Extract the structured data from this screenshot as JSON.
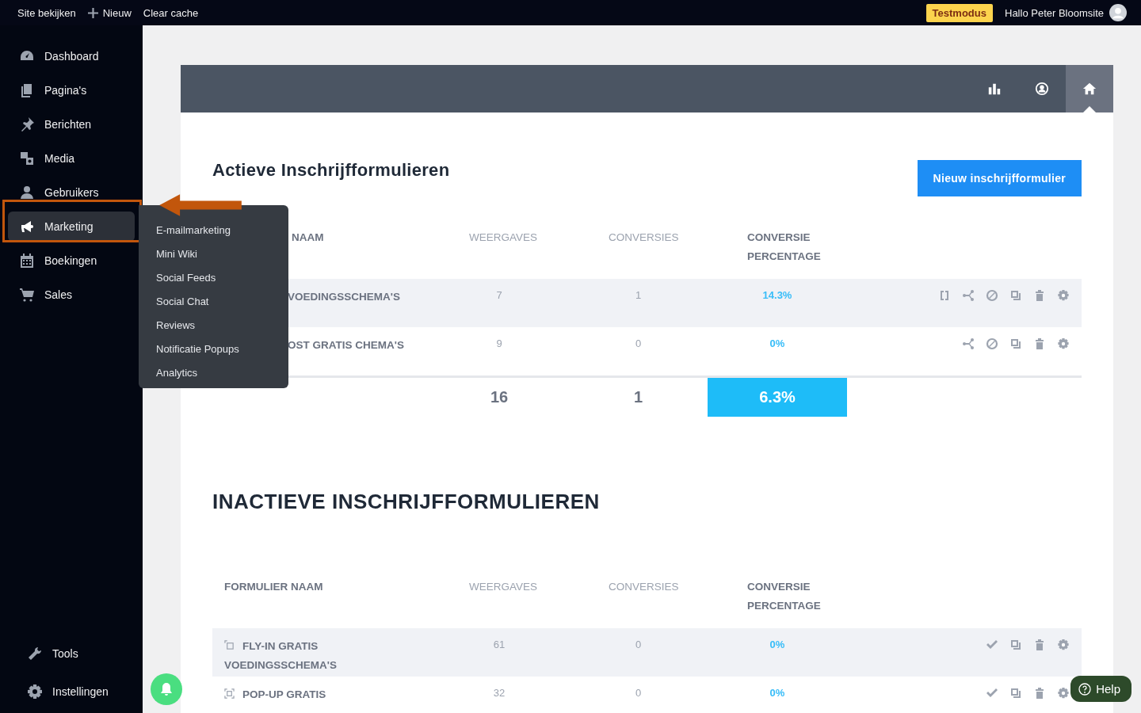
{
  "topbar": {
    "links": [
      {
        "kind": "site",
        "label": "Site bekijken"
      },
      {
        "kind": "new",
        "label": "Nieuw"
      },
      {
        "kind": "cache",
        "label": "Clear cache"
      }
    ],
    "badge": "Testmodus",
    "greeting": "Hallo Peter Bloomsite"
  },
  "sidebar": {
    "items": [
      {
        "kind": "dashboard",
        "label": "Dashboard",
        "selected": false
      },
      {
        "kind": "pages",
        "label": "Pagina's",
        "selected": false
      },
      {
        "kind": "pin",
        "label": "Berichten",
        "selected": false
      },
      {
        "kind": "media",
        "label": "Media",
        "selected": false
      },
      {
        "kind": "user",
        "label": "Gebruikers",
        "selected": false
      },
      {
        "kind": "megaphone",
        "label": "Marketing",
        "selected": true
      },
      {
        "kind": "calendar",
        "label": "Boekingen",
        "selected": false
      },
      {
        "kind": "cart",
        "label": "Sales",
        "selected": false
      }
    ],
    "bottom_items": [
      {
        "kind": "wrench",
        "label": "Tools",
        "selected": false
      },
      {
        "kind": "gear",
        "label": "Instellingen",
        "selected": false
      }
    ],
    "flyout": [
      "E-mailmarketing",
      "Mini Wiki",
      "Social Feeds",
      "Social Chat",
      "Reviews",
      "Notificatie Popups",
      "Analytics"
    ]
  },
  "tabs": [
    {
      "kind": "chart",
      "selected": false
    },
    {
      "kind": "user",
      "selected": false
    },
    {
      "kind": "home",
      "selected": true
    }
  ],
  "active": {
    "title": "Actieve Inschrijfformulieren",
    "new_button": "Nieuw inschrijfformulier",
    "columns": [
      "NAAM",
      "WEERGAVES",
      "CONVERSIES",
      "CONVERSIE PERCENTAGE"
    ],
    "rows": [
      {
        "name": "VOEDINGSSCHEMA'S",
        "views": "7",
        "conversions": "1",
        "percentage": "14.3%",
        "actions": [
          {
            "kind": "expand"
          },
          {
            "kind": "share"
          },
          {
            "kind": "disable"
          },
          {
            "kind": "duplicate"
          },
          {
            "kind": "delete"
          },
          {
            "kind": "settings"
          }
        ]
      },
      {
        "name": "OST GRATIS CHEMA'S",
        "views": "9",
        "conversions": "0",
        "percentage": "0%",
        "actions": [
          {
            "kind": "share"
          },
          {
            "kind": "disable"
          },
          {
            "kind": "duplicate"
          },
          {
            "kind": "delete"
          },
          {
            "kind": "settings"
          }
        ]
      }
    ],
    "totals": {
      "views": "16",
      "conversions": "1",
      "percentage": "6.3%"
    }
  },
  "inactive": {
    "title": "INACTIEVE INSCHRIJFFORMULIEREN",
    "columns": [
      "FORMULIER NAAM",
      "WEERGAVES",
      "CONVERSIES",
      "CONVERSIE PERCENTAGE"
    ],
    "rows": [
      {
        "kind": "slide-in",
        "name": "FLY-IN GRATIS VOEDINGSSCHEMA'S",
        "views": "61",
        "conversions": "0",
        "percentage": "0%",
        "actions": [
          {
            "kind": "activate"
          },
          {
            "kind": "duplicate"
          },
          {
            "kind": "delete"
          },
          {
            "kind": "settings"
          }
        ]
      },
      {
        "kind": "popup",
        "name": "POP-UP GRATIS",
        "views": "32",
        "conversions": "0",
        "percentage": "0%",
        "actions": [
          {
            "kind": "activate"
          },
          {
            "kind": "duplicate"
          },
          {
            "kind": "delete"
          },
          {
            "kind": "settings"
          }
        ]
      }
    ]
  },
  "help_button": "Help"
}
